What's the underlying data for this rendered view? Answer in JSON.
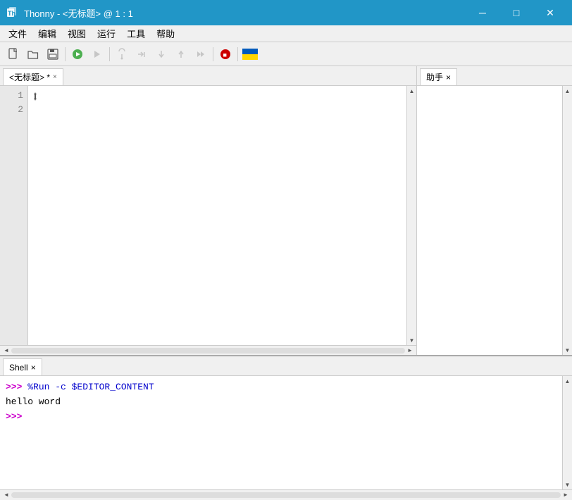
{
  "titlebar": {
    "title": "Thonny - <无标题> @ 1 : 1",
    "minimize_label": "─",
    "maximize_label": "□",
    "close_label": "✕"
  },
  "menubar": {
    "items": [
      "文件",
      "编辑",
      "视图",
      "运行",
      "工具",
      "帮助"
    ]
  },
  "toolbar": {
    "buttons": [
      {
        "name": "new",
        "icon": "📄"
      },
      {
        "name": "open",
        "icon": "📂"
      },
      {
        "name": "save",
        "icon": "💾"
      },
      {
        "name": "run",
        "icon": "▶"
      },
      {
        "name": "run-sel",
        "icon": "▷"
      },
      {
        "name": "debug",
        "icon": "↺"
      },
      {
        "name": "step-over",
        "icon": "↷"
      },
      {
        "name": "step-into",
        "icon": "↯"
      },
      {
        "name": "step-out",
        "icon": "↑"
      },
      {
        "name": "resume",
        "icon": "▶▶"
      },
      {
        "name": "stop",
        "icon": "⬛"
      },
      {
        "name": "flag",
        "icon": "🏴"
      }
    ]
  },
  "editor": {
    "tab_label": "<无标题> *",
    "tab_close": "×",
    "lines": [
      "",
      ""
    ],
    "line_numbers": [
      "1",
      "2"
    ]
  },
  "assistant": {
    "tab_label": "助手",
    "tab_close": "×"
  },
  "shell": {
    "tab_label": "Shell",
    "tab_close": "×",
    "lines": [
      {
        "type": "cmd",
        "prompt": ">>> ",
        "text": "%Run -c $EDITOR_CONTENT"
      },
      {
        "type": "output",
        "text": "hello word"
      },
      {
        "type": "prompt",
        "prompt": ">>> ",
        "text": ""
      }
    ]
  }
}
